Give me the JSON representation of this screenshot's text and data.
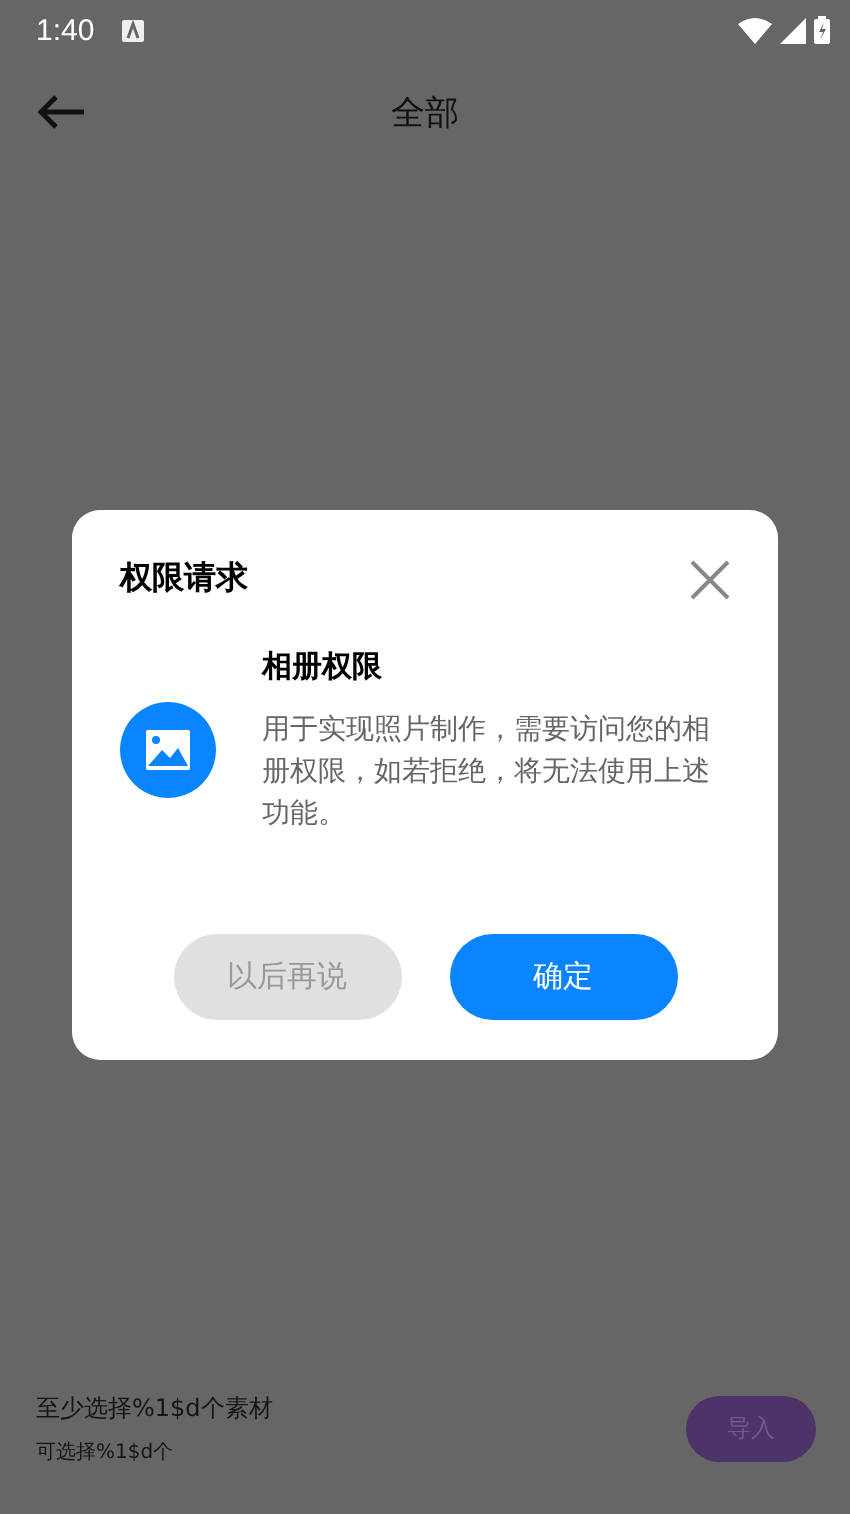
{
  "status_bar": {
    "time": "1:40"
  },
  "header": {
    "title": "全部"
  },
  "footer": {
    "hint": "至少选择%1$d个素材",
    "sub_hint": "可选择%1$d个",
    "import_button": "导入"
  },
  "dialog": {
    "title": "权限请求",
    "permission_title": "相册权限",
    "permission_text": "用于实现照片制作，需要访问您的相册权限，如若拒绝，将无法使用上述功能。",
    "buttons": [
      {
        "label": "以后再说",
        "kind": "secondary"
      },
      {
        "label": "确定",
        "kind": "primary"
      }
    ]
  }
}
